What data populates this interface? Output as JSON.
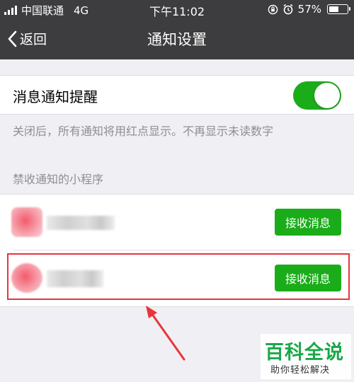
{
  "status_bar": {
    "carrier": "中国联通",
    "network": "4G",
    "time": "下午11:02",
    "battery_percent": "57%",
    "battery_level": 0.57
  },
  "nav": {
    "back_label": "返回",
    "title": "通知设置"
  },
  "notification_toggle": {
    "label": "消息通知提醒",
    "on": true
  },
  "description": "关闭后，所有通知将用红点显示。不再显示未读数字",
  "blocked_section": {
    "title": "禁收通知的小程序",
    "items": [
      {
        "button_label": "接收消息"
      },
      {
        "button_label": "接收消息"
      }
    ]
  },
  "watermark": {
    "main": "百科全说",
    "sub": "助你轻松解决"
  },
  "colors": {
    "nav_bg": "#3d3d3f",
    "accent_green": "#1aad19",
    "highlight_red": "#e8343b",
    "page_bg": "#efeff4"
  }
}
